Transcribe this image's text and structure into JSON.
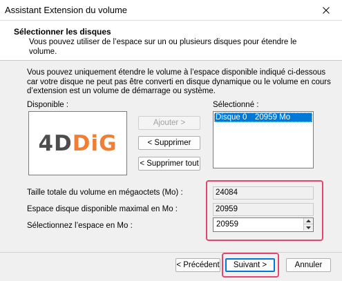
{
  "window": {
    "title": "Assistant Extension du volume"
  },
  "header": {
    "title": "Sélectionner les disques",
    "subtitle": "Vous pouvez utiliser de l’espace sur un ou plusieurs disques pour étendre le volume."
  },
  "intro": "Vous pouvez uniquement étendre le volume à l’espace disponible indiqué ci-dessous car votre disque ne peut pas être converti en disque dynamique ou le volume en cours d’extension est un volume de démarrage ou système.",
  "available": {
    "label": "Disponible :",
    "logo": {
      "part1": "4D",
      "part2": "DiG",
      "color_dark": "#4d4d4d",
      "color_accent": "#f07f35"
    }
  },
  "selected": {
    "label": "Sélectionné :",
    "items": [
      {
        "disk": "Disque 0",
        "size": "20959 Mo"
      }
    ]
  },
  "buttons": {
    "add": "Ajouter >",
    "remove": "< Supprimer",
    "remove_all": "< Supprimer tout",
    "back": "< Précédent",
    "next": "Suivant >",
    "cancel": "Annuler"
  },
  "fields": {
    "total_size": {
      "label": "Taille totale du volume en mégaoctets (Mo) :",
      "value": "24084"
    },
    "max_space": {
      "label": "Espace disque disponible maximal en Mo :",
      "value": "20959"
    },
    "select_space": {
      "label": "Sélectionnez l’espace en Mo :",
      "value": "20959"
    }
  },
  "colors": {
    "highlight": "#e8436e",
    "selection": "#0078d7"
  }
}
